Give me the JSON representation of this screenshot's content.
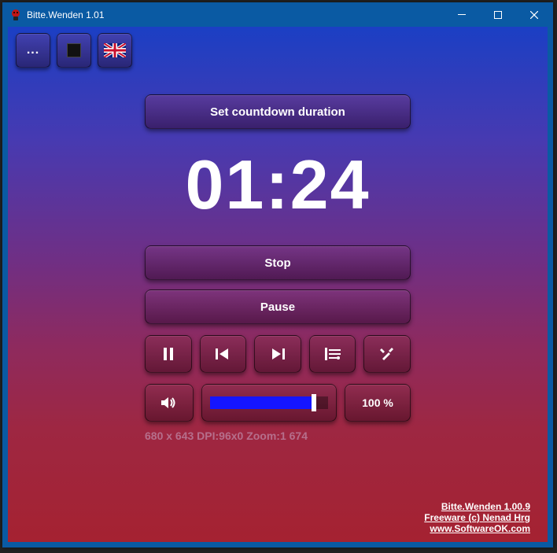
{
  "window": {
    "title": "Bitte.Wenden 1.01"
  },
  "toolbar": {
    "menu_label": "..."
  },
  "main": {
    "set_duration_label": "Set countdown duration",
    "timer_value": "01:24",
    "stop_label": "Stop",
    "pause_label": "Pause"
  },
  "volume": {
    "percent_label": "100 %",
    "level": 88
  },
  "debug_text": "680 x 643 DPI:96x0 Zoom:1 674",
  "footer": {
    "line1": "Bitte.Wenden 1.00.9",
    "line2": "Freeware (c) Nenad Hrg",
    "line3": "www.SoftwareOK.com"
  },
  "icons": {
    "pause": "pause-icon",
    "prev": "skip-back-icon",
    "next": "skip-forward-icon",
    "playlist": "playlist-icon",
    "tools": "tools-icon",
    "speaker": "speaker-icon",
    "stop_square": "stop-square-icon",
    "flag": "uk-flag-icon"
  }
}
